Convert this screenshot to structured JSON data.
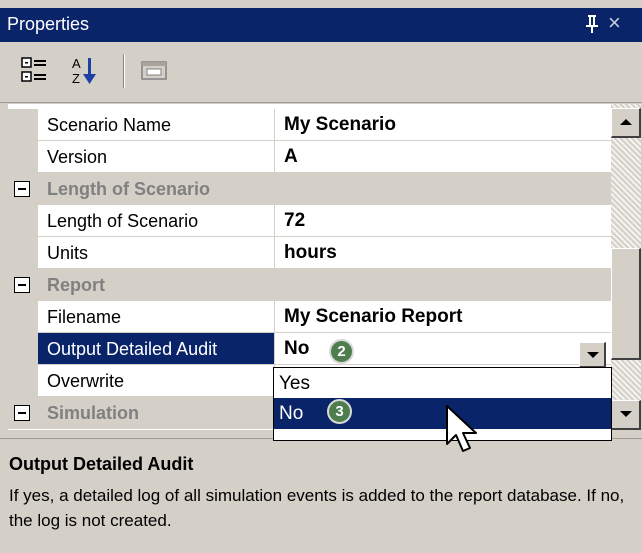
{
  "window": {
    "title": "Properties",
    "pin_icon": "pin-icon",
    "close_label": "×"
  },
  "toolbar": {
    "buttons": [
      {
        "name": "categorized-view-button",
        "icon": "categorized-icon"
      },
      {
        "name": "alphabetical-sort-button",
        "icon": "alphabetical-sort-icon",
        "text_top": "A",
        "text_bottom": "Z"
      },
      {
        "name": "property-pages-button",
        "icon": "property-pages-icon"
      }
    ]
  },
  "grid": {
    "rows": [
      {
        "type": "property",
        "name": "Scenario Name",
        "value": "My Scenario"
      },
      {
        "type": "property",
        "name": "Version",
        "value": "A"
      },
      {
        "type": "category",
        "label": "Length of Scenario",
        "expanded": true
      },
      {
        "type": "property",
        "name": "Length of Scenario",
        "value": "72"
      },
      {
        "type": "property",
        "name": "Units",
        "value": "hours"
      },
      {
        "type": "category",
        "label": "Report",
        "expanded": true
      },
      {
        "type": "property",
        "name": "Filename",
        "value": "My Scenario Report"
      },
      {
        "type": "property",
        "name": "Output Detailed Audit",
        "value": "No",
        "selected": true
      },
      {
        "type": "property",
        "name": "Overwrite",
        "value": ""
      },
      {
        "type": "category",
        "label": "Simulation",
        "expanded": true
      }
    ]
  },
  "dropdown": {
    "options": [
      "Yes",
      "No"
    ],
    "highlighted": "No"
  },
  "callouts": [
    "2",
    "3"
  ],
  "description": {
    "title": "Output Detailed Audit",
    "text": "If yes, a detailed log of all simulation events is added to the report database. If no, the log is not created."
  },
  "colors": {
    "selection": "#0a246a",
    "panel": "#d4d0c8",
    "callout": "#4e7e4e"
  }
}
